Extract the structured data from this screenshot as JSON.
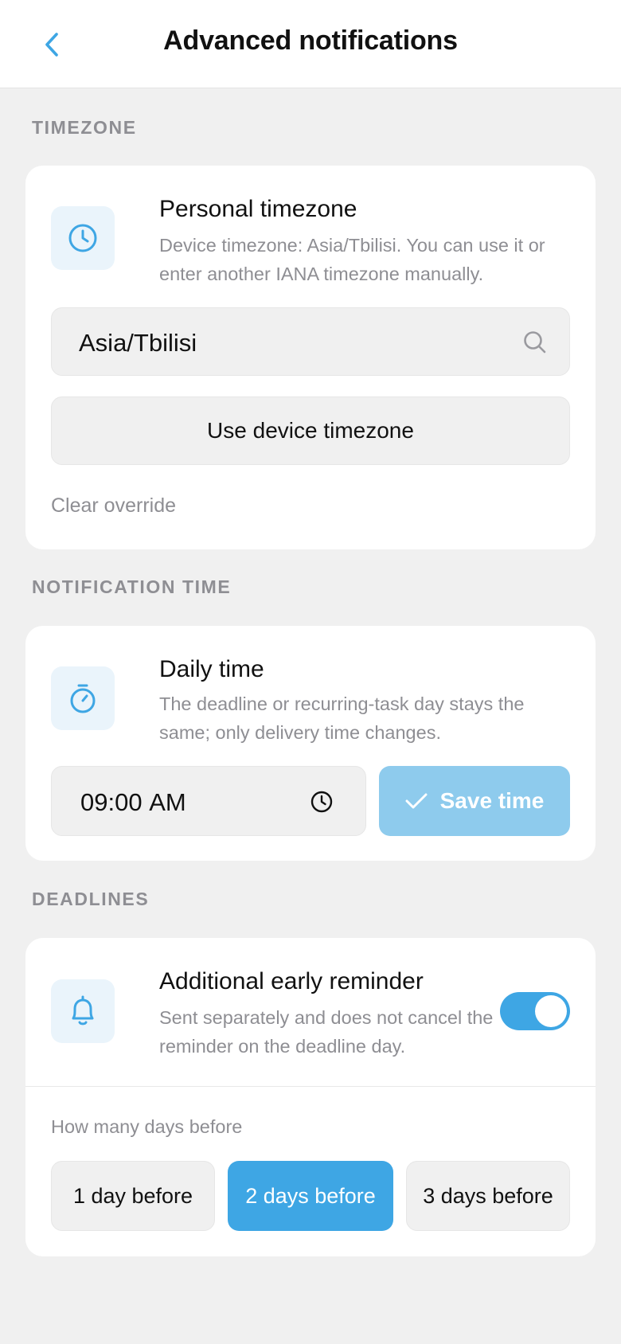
{
  "header": {
    "title": "Advanced notifications",
    "back_icon": "chevron-left-icon"
  },
  "colors": {
    "accent": "#3ea6e4",
    "accent_light": "#8ecbed",
    "muted": "#8e8e93",
    "background": "#f0f0f0"
  },
  "timezone": {
    "section_label": "TIMEZONE",
    "title": "Personal timezone",
    "description": "Device timezone: Asia/Tbilisi. You can use it or enter another IANA timezone manually.",
    "input_value": "Asia/Tbilisi",
    "use_device_button": "Use device timezone",
    "clear_override": "Clear override"
  },
  "notification_time": {
    "section_label": "NOTIFICATION TIME",
    "title": "Daily time",
    "description": "The deadline or recurring-task day stays the same; only delivery time changes.",
    "time_value": "09:00",
    "time_period": "AM",
    "save_button": "Save time"
  },
  "deadlines": {
    "section_label": "DEADLINES",
    "title": "Additional early reminder",
    "description": "Sent separately and does not cancel the reminder on the deadline day.",
    "toggle_on": true,
    "days_label": "How many days before",
    "options": [
      "1 day before",
      "2 days before",
      "3 days before"
    ],
    "selected_option": "2 days before"
  }
}
